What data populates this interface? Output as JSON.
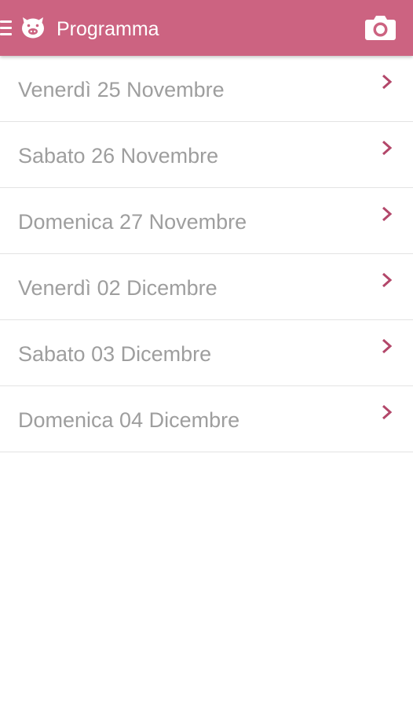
{
  "app": {
    "title": "Programma",
    "accent_color": "#cc6381",
    "toolbar_icons": [
      "menu-icon",
      "pig-logo-icon",
      "camera-icon"
    ]
  },
  "list": {
    "row_icon": "chevron-right-icon",
    "items": [
      {
        "label": "Venerdì 25 Novembre"
      },
      {
        "label": "Sabato 26 Novembre"
      },
      {
        "label": "Domenica 27 Novembre"
      },
      {
        "label": "Venerdì 02 Dicembre"
      },
      {
        "label": "Sabato 03 Dicembre"
      },
      {
        "label": "Domenica 04 Dicembre"
      }
    ]
  }
}
